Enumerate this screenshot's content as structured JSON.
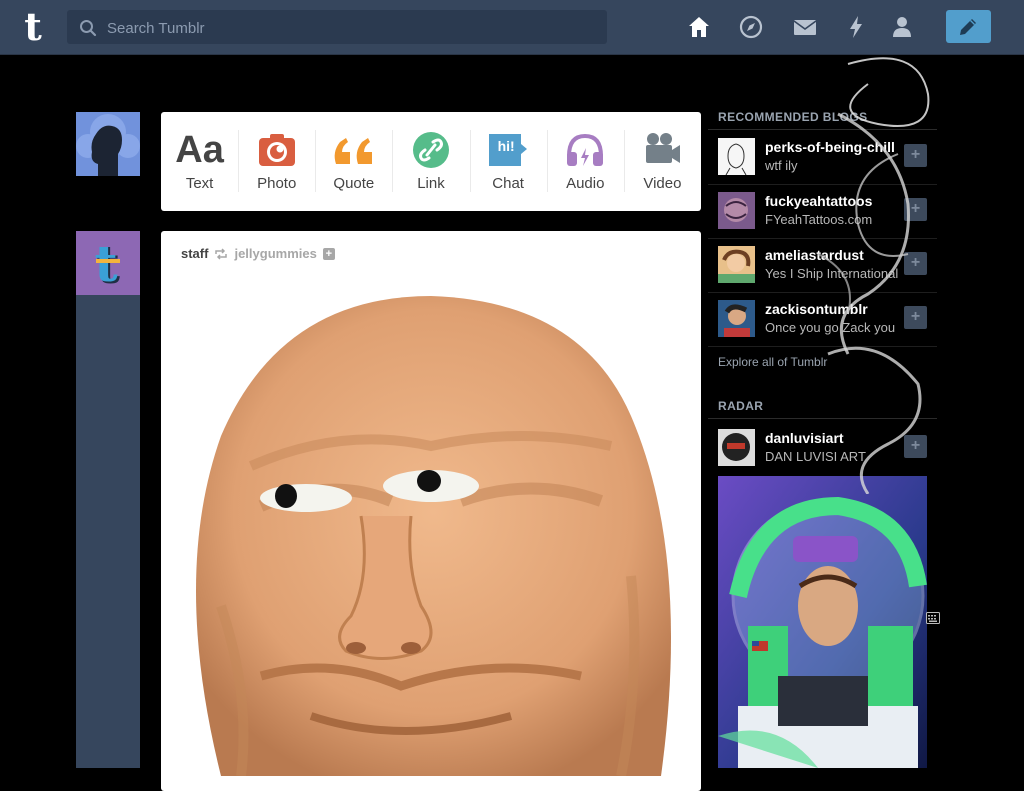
{
  "header": {
    "search_placeholder": "Search Tumblr",
    "icons": [
      "home-icon",
      "explore-compass-icon",
      "messages-envelope-icon",
      "activity-lightning-icon",
      "account-person-icon",
      "compose-pencil-icon"
    ]
  },
  "post_types": [
    {
      "label": "Text",
      "icon_text": "Aa",
      "color": "#444444"
    },
    {
      "label": "Photo",
      "color": "#d95e40"
    },
    {
      "label": "Quote",
      "icon_text": "“",
      "color": "#f2992e"
    },
    {
      "label": "Link",
      "color": "#56bc8a"
    },
    {
      "label": "Chat",
      "icon_text": "hi!",
      "color": "#529ecc"
    },
    {
      "label": "Audio",
      "color": "#a77dc2"
    },
    {
      "label": "Video",
      "color": "#748089"
    }
  ],
  "post": {
    "author": "staff",
    "reblogged_from": "jellygummies",
    "plus": "+"
  },
  "sidebar": {
    "recommended_title": "RECOMMENDED BLOGS",
    "blogs": [
      {
        "name": "perks-of-being-chill",
        "title": "wtf ily"
      },
      {
        "name": "fuckyeahtattoos",
        "title": "FYeahTattoos.com"
      },
      {
        "name": "ameliastardust",
        "title": "Yes I Ship International"
      },
      {
        "name": "zackisontumblr",
        "title": "Once you go Zack you"
      }
    ],
    "explore_label": "Explore all of Tumblr",
    "radar_title": "RADAR",
    "radar_blog": {
      "name": "danluvisiart",
      "title": "DAN LUVISI ART"
    }
  },
  "colors": {
    "header_bg": "#36465d",
    "page_bg": "#000000",
    "compose_bg": "#529ecc"
  }
}
